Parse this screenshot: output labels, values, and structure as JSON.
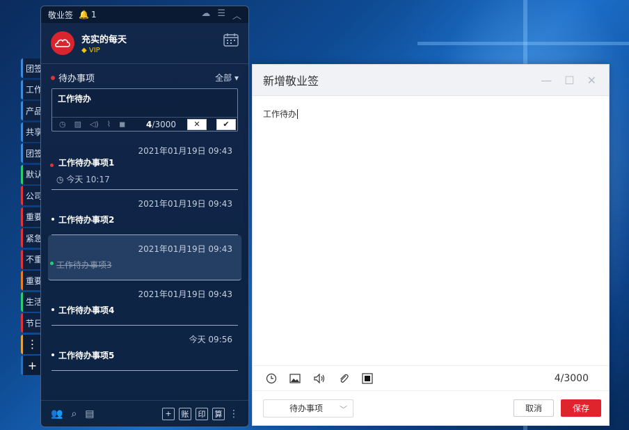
{
  "panel": {
    "app_name": "敬业签",
    "notification_count": "1",
    "user_name": "充实的每天",
    "vip_label": "VIP",
    "list_title": "待办事项",
    "filter_label": "全部",
    "editor_text": "工作待办",
    "char_count_current": "4",
    "char_count_max": "/3000"
  },
  "tags": [
    "团签",
    "工作",
    "产品",
    "共享",
    "团签",
    "默认",
    "公司",
    "重要",
    "紧急",
    "不重",
    "重要",
    "生活",
    "节日"
  ],
  "items": [
    {
      "time": "2021年01月19日 09:43",
      "title": "工作待办事项1",
      "remind": "今天 10:17"
    },
    {
      "time": "2021年01月19日 09:43",
      "title": "工作待办事项2"
    },
    {
      "time": "2021年01月19日 09:43",
      "title": "工作待办事项3"
    },
    {
      "time": "2021年01月19日 09:43",
      "title": "工作待办事项4"
    },
    {
      "time": "今天 09:56",
      "title": "工作待办事项5"
    }
  ],
  "bottombar": {
    "btn_zhang": "账",
    "btn_yin": "印",
    "btn_suan": "算"
  },
  "dialog": {
    "title": "新增敬业签",
    "content": "工作待办",
    "count": "4/3000",
    "category": "待办事项",
    "cancel_label": "取消",
    "save_label": "保存"
  },
  "colors": {
    "accent_red": "#e0242d",
    "panel_bg": "#0f2446",
    "done_green": "#2ecc71"
  }
}
